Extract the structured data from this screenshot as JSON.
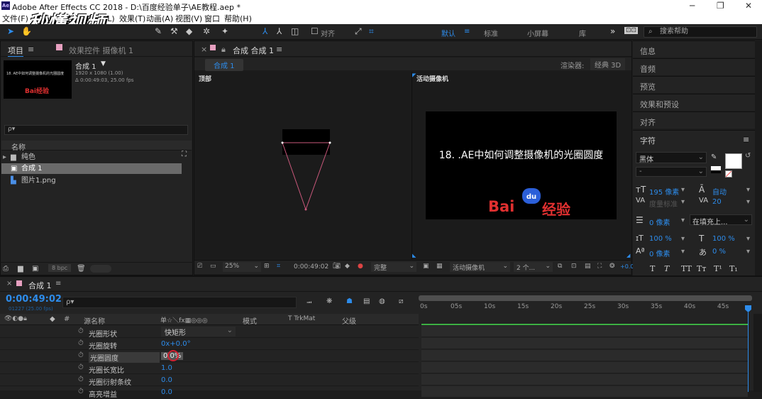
{
  "window": {
    "title": "Adobe After Effects CC 2018 - D:\\百度经验单子\\AE教程.aep *",
    "app_icon": "Ae"
  },
  "menu": [
    "文件(F)",
    "编辑(E)",
    "合成(C)",
    "图层(L)",
    "效果(T)",
    "动画(A)",
    "视图(V)",
    "窗口",
    "帮助(H)"
  ],
  "watermark": "秒懂视频",
  "toolbar": {
    "align_label": "对齐",
    "workspaces": [
      "默认",
      "标准",
      "小屏幕",
      "库"
    ],
    "more": "»",
    "search_placeholder": "搜索帮助"
  },
  "project_panel": {
    "tab_project": "项目",
    "tab_effects": "效果控件 摄像机 1",
    "comp_name": "合成 1",
    "comp_info": [
      "1920 x 1080 (1.00)",
      "Δ 0:00:49:03, 25.00 fps"
    ],
    "thumb_text": "18. AE中如何调整摄像机的光圈圆度",
    "thumb_logo": "Bai经验",
    "search_placeholder": "ρ▾",
    "col_name": "名称",
    "items": [
      {
        "name": "纯色",
        "type": "folder"
      },
      {
        "name": "合成 1",
        "type": "comp",
        "selected": true
      },
      {
        "name": "图片1.png",
        "type": "image"
      }
    ],
    "bpc": "8 bpc"
  },
  "comp_panel": {
    "tab": "合成 合成 1",
    "breadcrumb": "合成 1",
    "renderer_label": "渲染器:",
    "renderer_value": "经典 3D",
    "left_view_label": "顶部",
    "right_view_label": "活动摄像机",
    "preview_title": "18. .AE中如何调整摄像机的光圈圆度",
    "preview_logo_red": "Bai",
    "preview_logo_blue": "du",
    "preview_logo_cn": "经验",
    "zoom": "25%",
    "timecode": "0:00:49:02",
    "quality": "完整",
    "camera": "活动摄像机",
    "views": "2 个...",
    "exposure": "+0.0"
  },
  "right_panels": {
    "items": [
      "信息",
      "音频",
      "预览",
      "效果和预设",
      "对齐",
      "字符"
    ],
    "font": "黑体",
    "font_style": "-",
    "size": "195 像素",
    "leading": "自动",
    "kerning": "度量标准",
    "tracking": "20",
    "stroke": "0 像素",
    "stroke_mode": "在填充上...",
    "vscale": "100 %",
    "hscale": "100 %",
    "baseline": "0 像素",
    "tsume": "0 %",
    "styles": [
      "T",
      "T",
      "TT",
      "Tт",
      "T¹",
      "T₁"
    ]
  },
  "timeline": {
    "tab": "合成 1",
    "timecode": "0:00:49:02",
    "frames": "01227 (25.00 fps)",
    "search_placeholder": "ρ▾",
    "col_source": "源名称",
    "col_mode": "模式",
    "col_trkmat": "T TrkMat",
    "col_parent": "父级",
    "col_switches": "单☆＼fx▦◎◎◎",
    "properties": [
      {
        "name": "光圈形状",
        "value": "快矩形",
        "dropdown": true
      },
      {
        "name": "光圈旋转",
        "value": "0x+0.0°"
      },
      {
        "name": "光圈圆度",
        "value": "0.0%",
        "selected": true
      },
      {
        "name": "光圈长宽比",
        "value": "1.0"
      },
      {
        "name": "光圈衍射条纹",
        "value": "0.0"
      },
      {
        "name": "高亮增益",
        "value": "0.0"
      }
    ],
    "ruler": [
      "0s",
      "05s",
      "10s",
      "15s",
      "20s",
      "25s",
      "30s",
      "35s",
      "40s",
      "45s"
    ]
  },
  "colors": {
    "accent": "#2d8ceb",
    "bg": "#1d1d1d",
    "panel": "#232323",
    "logo_red": "#e03030",
    "logo_blue": "#2b5fd9",
    "green": "#3cb043"
  }
}
